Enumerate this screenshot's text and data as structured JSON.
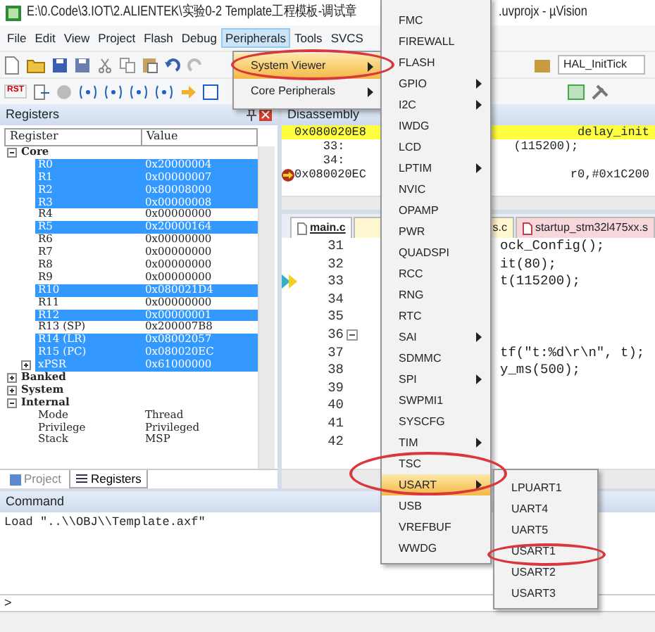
{
  "window": {
    "title": "E:\\0.Code\\3.IOT\\2.ALIENTEK\\实验0-2 Template工程模板-调试章",
    "title_tail": ".uvprojx - µVision"
  },
  "menu_bar": [
    {
      "label": "File",
      "selected": false
    },
    {
      "label": "Edit",
      "selected": false
    },
    {
      "label": "View",
      "selected": false
    },
    {
      "label": "Project",
      "selected": false
    },
    {
      "label": "Flash",
      "selected": false
    },
    {
      "label": "Debug",
      "selected": false
    },
    {
      "label": "Peripherals",
      "selected": true
    },
    {
      "label": "Tools",
      "selected": false
    },
    {
      "label": "SVCS",
      "selected": false
    }
  ],
  "toolbar": {
    "reset_label": "RST",
    "function_combo": "HAL_InitTick"
  },
  "registers_panel": {
    "title": "Registers",
    "columns": [
      "Register",
      "Value"
    ],
    "tree": [
      {
        "name": "Core",
        "expanded": true,
        "children": [
          {
            "name": "R0",
            "value": "0x20000004",
            "selected": true
          },
          {
            "name": "R1",
            "value": "0x00000007",
            "selected": true
          },
          {
            "name": "R2",
            "value": "0x80008000",
            "selected": true
          },
          {
            "name": "R3",
            "value": "0x00000008",
            "selected": true
          },
          {
            "name": "R4",
            "value": "0x00000000",
            "selected": false
          },
          {
            "name": "R5",
            "value": "0x20000164",
            "selected": true
          },
          {
            "name": "R6",
            "value": "0x00000000",
            "selected": false
          },
          {
            "name": "R7",
            "value": "0x00000000",
            "selected": false
          },
          {
            "name": "R8",
            "value": "0x00000000",
            "selected": false
          },
          {
            "name": "R9",
            "value": "0x00000000",
            "selected": false
          },
          {
            "name": "R10",
            "value": "0x080021D4",
            "selected": true
          },
          {
            "name": "R11",
            "value": "0x00000000",
            "selected": false
          },
          {
            "name": "R12",
            "value": "0x00000001",
            "selected": true
          },
          {
            "name": "R13 (SP)",
            "value": "0x200007B8",
            "selected": false
          },
          {
            "name": "R14 (LR)",
            "value": "0x08002057",
            "selected": true
          },
          {
            "name": "R15 (PC)",
            "value": "0x080020EC",
            "selected": true
          },
          {
            "name": "xPSR",
            "value": "0x61000000",
            "selected": true,
            "expanded": false
          }
        ]
      },
      {
        "name": "Banked",
        "expanded": false
      },
      {
        "name": "System",
        "expanded": false
      },
      {
        "name": "Internal",
        "expanded": true,
        "children": [
          {
            "name": "Mode",
            "value": "Thread",
            "selected": false
          },
          {
            "name": "Privilege",
            "value": "Privileged",
            "selected": false
          },
          {
            "name": "Stack",
            "value": "MSP",
            "selected": false
          }
        ]
      }
    ],
    "tabs": [
      {
        "label": "Project",
        "selected": false
      },
      {
        "label": "Registers",
        "selected": true
      }
    ]
  },
  "disassembly": {
    "title": "Disassembly",
    "rows": [
      {
        "left": "0x080020E8",
        "right": "delay_init",
        "highlighted": true,
        "pc_marker": false
      },
      {
        "left": "    33:",
        "right": "(115200);",
        "highlighted": false,
        "pc_marker": false
      },
      {
        "left": "    34:",
        "right": "",
        "highlighted": false,
        "pc_marker": false
      },
      {
        "left": "0x080020EC",
        "right": "r0,#0x1C200",
        "highlighted": false,
        "pc_marker": true
      }
    ]
  },
  "editor": {
    "tabs": [
      {
        "label": "main.c",
        "selected": true,
        "kind": "c"
      },
      {
        "label": "s.c",
        "selected": false,
        "kind": "c"
      },
      {
        "label": "startup_stm32l475xx.s",
        "selected": false,
        "kind": "asm"
      }
    ],
    "lines": [
      {
        "number": "31",
        "code": "ock_Config();",
        "current": false,
        "fold": false
      },
      {
        "number": "32",
        "code": "it(80);",
        "current": false,
        "fold": false
      },
      {
        "number": "33",
        "code": "t(115200);",
        "current": true,
        "fold": false
      },
      {
        "number": "34",
        "current": false,
        "fold": false
      },
      {
        "number": "35",
        "current": false,
        "fold": false
      },
      {
        "number": "36",
        "current": false,
        "fold": true
      },
      {
        "number": "37",
        "code": "tf(\"t:%d\\r\\n\", t);",
        "current": false,
        "fold": false
      },
      {
        "number": "38",
        "code": "y_ms(500);",
        "current": false,
        "fold": false
      },
      {
        "number": "39",
        "current": false,
        "fold": false
      },
      {
        "number": "40",
        "current": false,
        "fold": false
      },
      {
        "number": "41",
        "current": false,
        "fold": false
      },
      {
        "number": "42",
        "current": false,
        "fold": false
      }
    ]
  },
  "command": {
    "title": "Command",
    "output": "Load \"..\\\\OBJ\\\\Template.axf\"",
    "prompt": ">"
  },
  "peripherals_menu": [
    {
      "label": "System Viewer",
      "selected": true,
      "has_submenu": true
    },
    {
      "label": "Core Peripherals",
      "selected": false,
      "has_submenu": true
    }
  ],
  "system_viewer_menu": [
    {
      "label": "FMC",
      "selected": false,
      "has_submenu": false
    },
    {
      "label": "FIREWALL",
      "selected": false,
      "has_submenu": false
    },
    {
      "label": "FLASH",
      "selected": false,
      "has_submenu": false
    },
    {
      "label": "GPIO",
      "selected": false,
      "has_submenu": true
    },
    {
      "label": "I2C",
      "selected": false,
      "has_submenu": true
    },
    {
      "label": "IWDG",
      "selected": false,
      "has_submenu": false
    },
    {
      "label": "LCD",
      "selected": false,
      "has_submenu": false
    },
    {
      "label": "LPTIM",
      "selected": false,
      "has_submenu": true
    },
    {
      "label": "NVIC",
      "selected": false,
      "has_submenu": false
    },
    {
      "label": "OPAMP",
      "selected": false,
      "has_submenu": false
    },
    {
      "label": "PWR",
      "selected": false,
      "has_submenu": false
    },
    {
      "label": "QUADSPI",
      "selected": false,
      "has_submenu": false
    },
    {
      "label": "RCC",
      "selected": false,
      "has_submenu": false
    },
    {
      "label": "RNG",
      "selected": false,
      "has_submenu": false
    },
    {
      "label": "RTC",
      "selected": false,
      "has_submenu": false
    },
    {
      "label": "SAI",
      "selected": false,
      "has_submenu": true
    },
    {
      "label": "SDMMC",
      "selected": false,
      "has_submenu": false
    },
    {
      "label": "SPI",
      "selected": false,
      "has_submenu": true
    },
    {
      "label": "SWPMI1",
      "selected": false,
      "has_submenu": false
    },
    {
      "label": "SYSCFG",
      "selected": false,
      "has_submenu": false
    },
    {
      "label": "TIM",
      "selected": false,
      "has_submenu": true
    },
    {
      "label": "TSC",
      "selected": false,
      "has_submenu": false
    },
    {
      "label": "USART",
      "selected": true,
      "has_submenu": true
    },
    {
      "label": "USB",
      "selected": false,
      "has_submenu": false
    },
    {
      "label": "VREFBUF",
      "selected": false,
      "has_submenu": false
    },
    {
      "label": "WWDG",
      "selected": false,
      "has_submenu": false
    }
  ],
  "usart_menu": [
    {
      "label": "LPUART1",
      "selected": false
    },
    {
      "label": "UART4",
      "selected": false
    },
    {
      "label": "UART5",
      "selected": false
    },
    {
      "label": "USART1",
      "selected": false
    },
    {
      "label": "USART2",
      "selected": false
    },
    {
      "label": "USART3",
      "selected": false
    }
  ]
}
